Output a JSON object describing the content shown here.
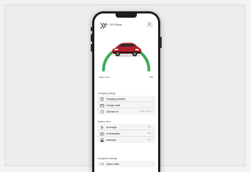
{
  "header": {
    "vehicle_name": "DS 3 Nova",
    "close_icon": "close-icon"
  },
  "gauge": {
    "start_label": "Battery level",
    "end_label": "80%",
    "track_color": "#dcdcdc",
    "fill_color": "#3aaa5c",
    "fill_fraction": 1.0
  },
  "charging_settings": {
    "title": "Charging settings",
    "items": [
      {
        "label": "Charging providers",
        "value": "",
        "icon": "plug-icon"
      },
      {
        "label": "Charge cards",
        "value": "",
        "icon": "card-icon"
      },
      {
        "label": "Optimise for",
        "value": "Slightly longer",
        "icon": "speedometer-icon"
      }
    ]
  },
  "battery_level": {
    "title": "Battery level",
    "items": [
      {
        "label": "At charger",
        "value": "15%",
        "icon": "charger-icon"
      },
      {
        "label": "At destination",
        "value": "15%",
        "icon": "destination-icon"
      },
      {
        "label": "Maximum",
        "value": "80%",
        "icon": "battery-icon"
      }
    ]
  },
  "navigation_settings": {
    "title": "Navigation settings",
    "items": [
      {
        "label": "Speed offset",
        "value": "",
        "icon": "gauge-icon"
      }
    ]
  }
}
